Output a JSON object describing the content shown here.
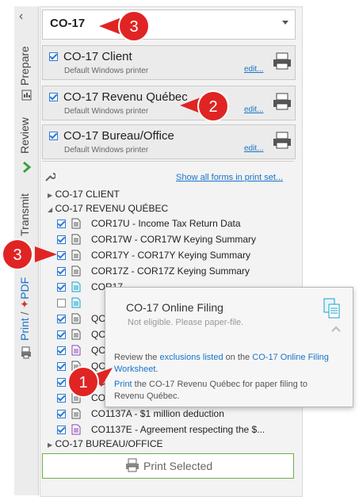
{
  "dropdown": {
    "value": "CO-17"
  },
  "side_tabs": {
    "prepare": "Prepare",
    "review": "Review",
    "transmit": "Transmit",
    "print": "Print",
    "slash": " / ",
    "pdf": "PDF"
  },
  "print_sets": [
    {
      "title": "CO-17 Client",
      "subtitle": "Default Windows printer",
      "edit": "edit..."
    },
    {
      "title": "CO-17 Revenu Québec",
      "subtitle": "Default Windows printer",
      "edit": "edit..."
    },
    {
      "title": "CO-17 Bureau/Office",
      "subtitle": "Default Windows printer",
      "edit": "edit..."
    }
  ],
  "show_all_link": "Show all forms in print set...",
  "tree": {
    "groups": [
      "CO-17 CLIENT",
      "CO-17 REVENU QUÉBEC",
      "CO-17 BUREAU/OFFICE"
    ],
    "items": [
      {
        "label": "COR17U - Income Tax Return Data",
        "checked": true
      },
      {
        "label": "COR17W - COR17W Keying Summary",
        "checked": true
      },
      {
        "label": "COR17Y - COR17Y Keying Summary",
        "checked": true
      },
      {
        "label": "COR17Z - COR17Z Keying Summary",
        "checked": true
      },
      {
        "label": "COR17...",
        "checked": true
      },
      {
        "label": "",
        "checked": false
      },
      {
        "label": "QC",
        "checked": true
      },
      {
        "label": "QC",
        "checked": true
      },
      {
        "label": "QC",
        "checked": true
      },
      {
        "label": "QC",
        "checked": true
      },
      {
        "label": "QC",
        "checked": true
      },
      {
        "label": "CO",
        "checked": true
      },
      {
        "label": "CO1137A - $1 million deduction",
        "checked": true
      },
      {
        "label": "CO1137E - Agreement respecting the $...",
        "checked": true
      }
    ]
  },
  "print_button": "Print Selected",
  "tooltip": {
    "title": "CO-17 Online Filing",
    "subtitle": "Not eligible. Please paper-file.",
    "line1_pre": "Review the ",
    "line1_link1": "exclusions listed",
    "line1_mid": " on the ",
    "line1_link2": "CO-17 Online Filing",
    "line2_link": "Worksheet",
    "line2_post": ".",
    "line3_link": "Print",
    "line3_post": " the CO-17 Revenu Québec for paper filing to",
    "line4": "Revenu Québec."
  },
  "callouts": [
    "3",
    "2",
    "3",
    "1"
  ],
  "colors": {
    "accent": "#1a73c8",
    "callout": "#e02424",
    "print_border": "#6ab04c"
  }
}
